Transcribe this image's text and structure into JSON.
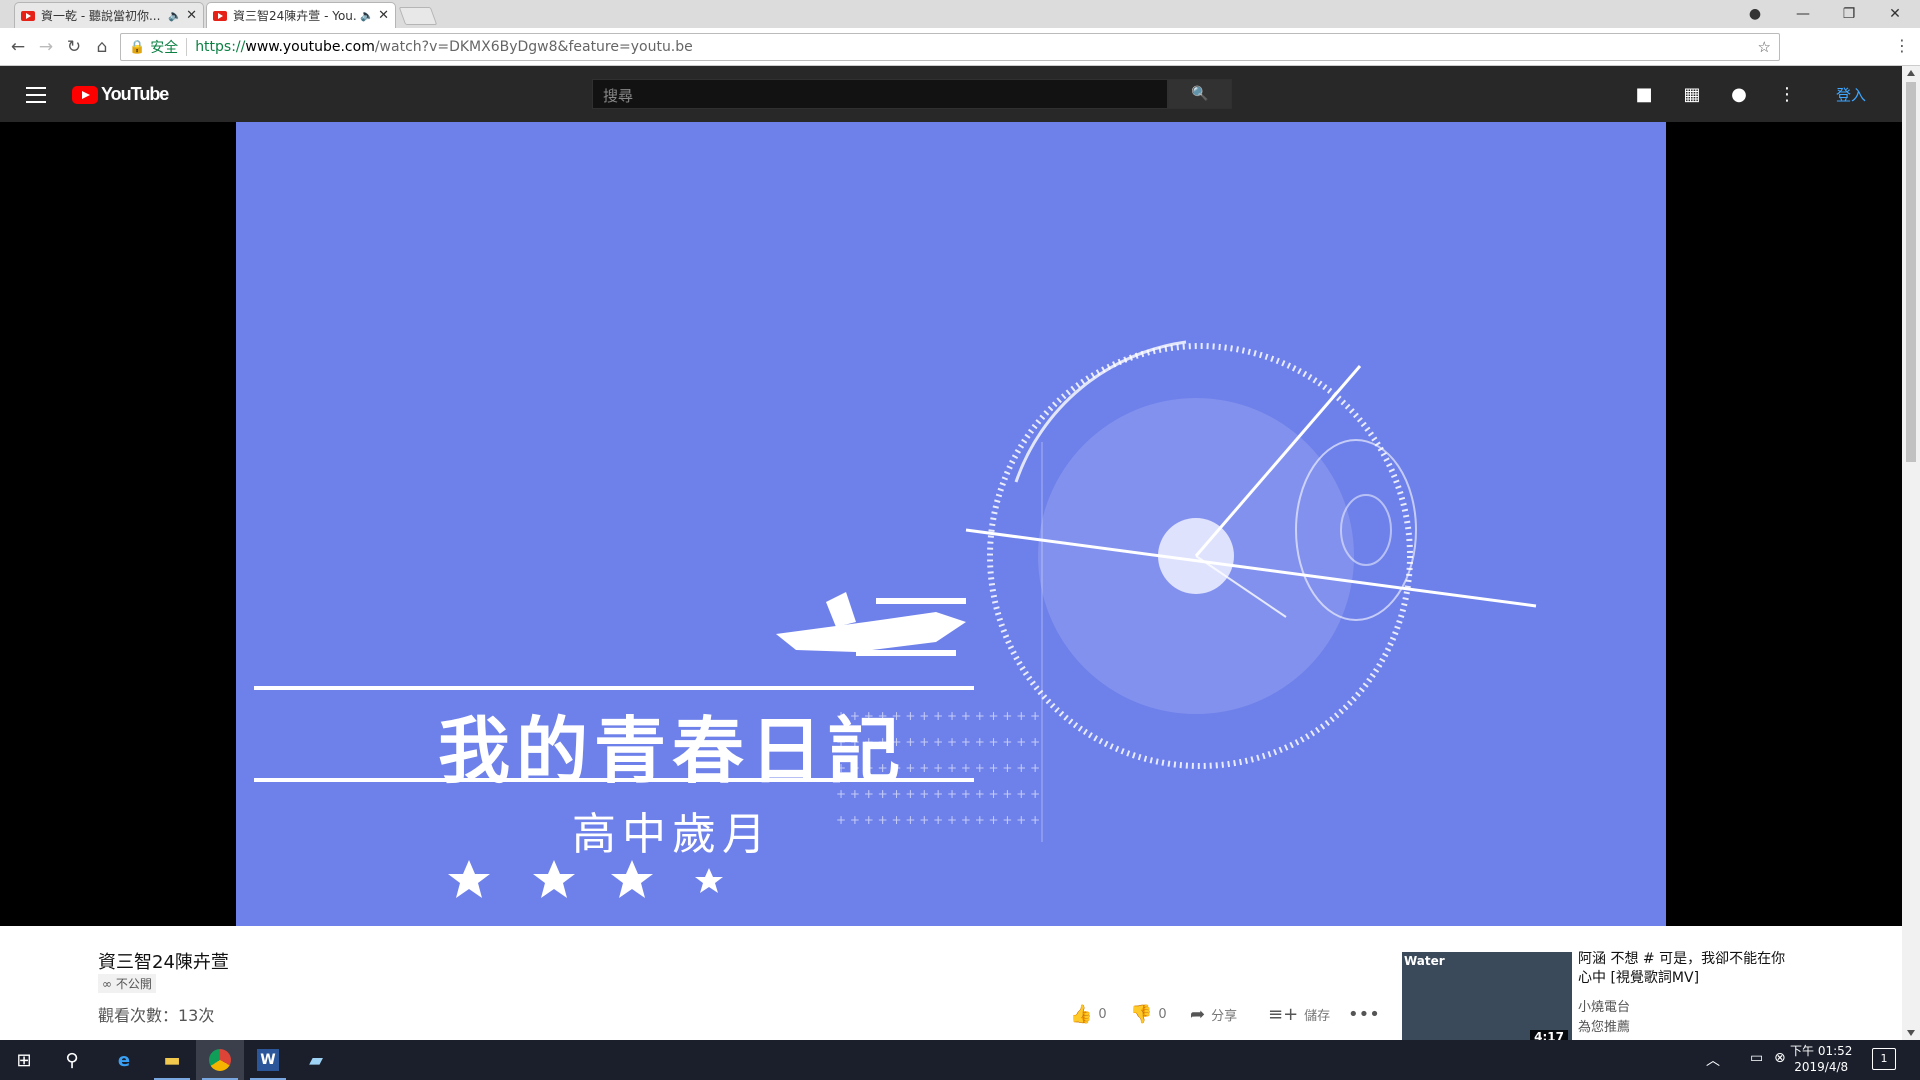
{
  "browser": {
    "tabs": [
      {
        "title": "資一乾 - 聽說當初你...",
        "active": false
      },
      {
        "title": "資三智24陳卉萱 - You...",
        "active": true
      }
    ],
    "omnibox": {
      "secure_label": "安全",
      "url_prefix": "https://",
      "url_host": "www.youtube.com",
      "url_path": "/watch?v=DKMX6ByDgw8&feature=youtu.be"
    }
  },
  "youtube": {
    "logo_text": "YouTube",
    "search_placeholder": "搜尋",
    "signin_label": "登入"
  },
  "video": {
    "overlay_title": "我的青春日記",
    "overlay_subtitle": "高中歲月"
  },
  "info": {
    "title": "資三智24陳卉萱",
    "privacy": "不公開",
    "views": "觀看次數：13次",
    "likes": "0",
    "dislikes": "0",
    "share_label": "分享",
    "save_label": "儲存"
  },
  "recommendation": {
    "title": "阿涵 不想 # 可是，我卻不能在你心中 [視覺歌詞MV]",
    "channel": "小燒電台",
    "reason": "為您推薦",
    "duration": "4:17",
    "thumb_text": "Water"
  },
  "taskbar": {
    "time": "下午 01:52",
    "date": "2019/4/8",
    "notification_count": "1"
  },
  "colors": {
    "video_bg": "#6e80ea",
    "youtube_header": "#282828",
    "youtube_red": "#ff0000",
    "signin_blue": "#3ea6ff"
  }
}
